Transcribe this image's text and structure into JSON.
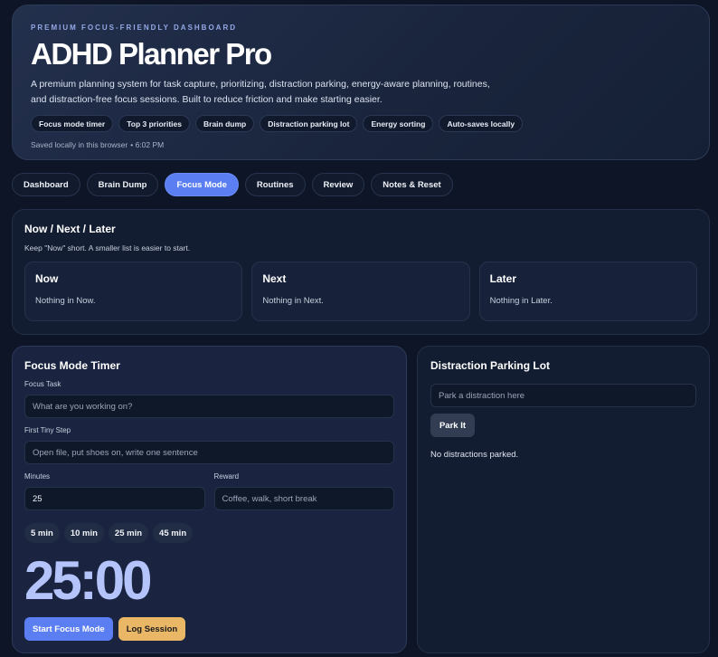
{
  "hero": {
    "eyebrow": "PREMIUM FOCUS-FRIENDLY DASHBOARD",
    "title": "ADHD Planner Pro",
    "description": "A premium planning system for task capture, prioritizing, distraction parking, energy-aware planning, routines, and distraction-free focus sessions. Built to reduce friction and make starting easier.",
    "chips": [
      "Focus mode timer",
      "Top 3 priorities",
      "Brain dump",
      "Distraction parking lot",
      "Energy sorting",
      "Auto-saves locally"
    ],
    "saved_text": "Saved locally in this browser",
    "saved_time": "• 6:02 PM"
  },
  "tabs": [
    {
      "label": "Dashboard",
      "active": false
    },
    {
      "label": "Brain Dump",
      "active": false
    },
    {
      "label": "Focus Mode",
      "active": true
    },
    {
      "label": "Routines",
      "active": false
    },
    {
      "label": "Review",
      "active": false
    },
    {
      "label": "Notes & Reset",
      "active": false
    }
  ],
  "now_next_later": {
    "title": "Now / Next / Later",
    "subtitle": "Keep \"Now\" short. A smaller list is easier to start.",
    "columns": [
      {
        "title": "Now",
        "empty": "Nothing in Now."
      },
      {
        "title": "Next",
        "empty": "Nothing in Next."
      },
      {
        "title": "Later",
        "empty": "Nothing in Later."
      }
    ]
  },
  "focus_timer": {
    "title": "Focus Mode Timer",
    "task_label": "Focus Task",
    "task_placeholder": "What are you working on?",
    "step_label": "First Tiny Step",
    "step_placeholder": "Open file, put shoes on, write one sentence",
    "minutes_label": "Minutes",
    "minutes_value": "25",
    "reward_label": "Reward",
    "reward_placeholder": "Coffee, walk, short break",
    "presets": [
      "5 min",
      "10 min",
      "25 min",
      "45 min"
    ],
    "timer_display": "25:00",
    "start_label": "Start Focus Mode",
    "log_label": "Log Session"
  },
  "parking_lot": {
    "title": "Distraction Parking Lot",
    "placeholder": "Park a distraction here",
    "button_label": "Park It",
    "empty": "No distractions parked."
  },
  "colors": {
    "background": "#0d1526",
    "accent": "#5b7ff2",
    "timer": "#b4c4fb",
    "warm": "#e9b765"
  }
}
